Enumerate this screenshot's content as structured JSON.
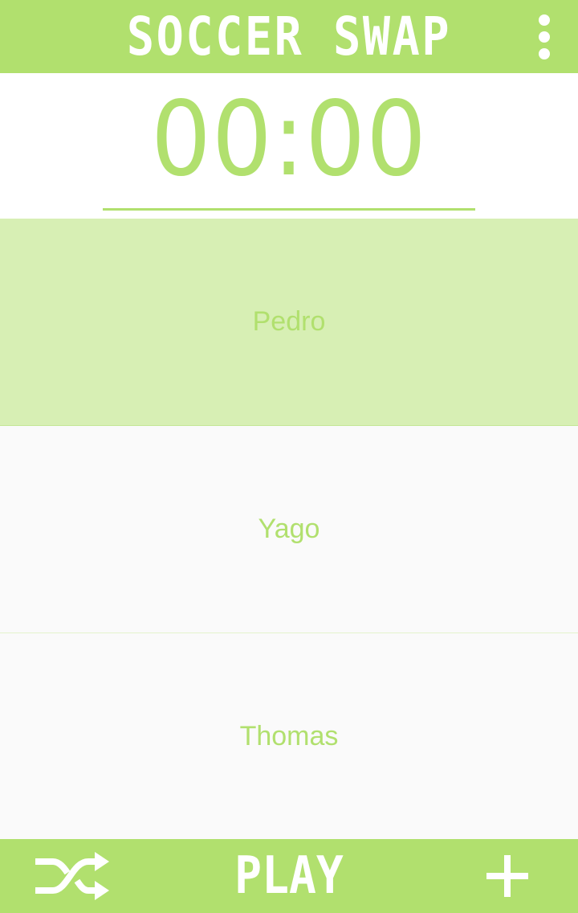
{
  "header": {
    "title": "SOCCER SWAP",
    "menu_icon": "more-vert-icon"
  },
  "timer": {
    "value": "00:00"
  },
  "players": [
    {
      "name": "Pedro",
      "selected": true
    },
    {
      "name": "Yago",
      "selected": false
    },
    {
      "name": "Thomas",
      "selected": false
    }
  ],
  "bottom_bar": {
    "shuffle_icon": "shuffle-icon",
    "play_label": "PLAY",
    "add_icon": "plus-icon"
  },
  "colors": {
    "accent": "#b1e06e",
    "selected_row": "#d7efb4",
    "row_background": "#fafafa",
    "white": "#ffffff"
  }
}
